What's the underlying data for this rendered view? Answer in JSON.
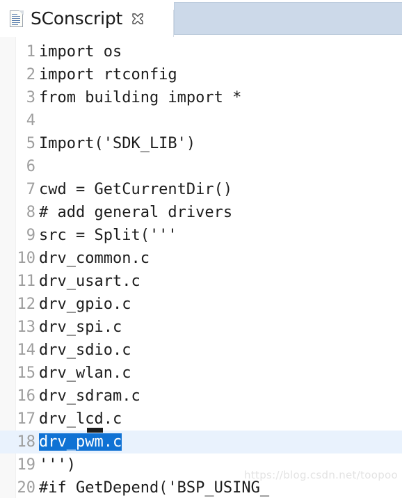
{
  "window": {
    "type": "code-editor",
    "colors": {
      "background": "#ffffff",
      "tab_inactive_area": "#ccd9e9",
      "line_number": "#9e9e9e",
      "code_text": "#1c1c1c",
      "selection": "#1072d4",
      "selection_text": "#ffffff",
      "current_line": "#e9f2fd",
      "marker_bar": "#f8f8f8"
    }
  },
  "tab_bar": {
    "tabs": [
      {
        "label": "SConscript",
        "icon": "file-document-icon",
        "close_icon": "close-x-icon",
        "active": true
      }
    ]
  },
  "editor": {
    "language": "python",
    "current_line": 18,
    "selection": {
      "line": 18,
      "text": "drv_pwm.c"
    },
    "lines": [
      {
        "n": "1",
        "text": "import os"
      },
      {
        "n": "2",
        "text": "import rtconfig"
      },
      {
        "n": "3",
        "text": "from building import *"
      },
      {
        "n": "4",
        "text": ""
      },
      {
        "n": "5",
        "text": "Import('SDK_LIB')"
      },
      {
        "n": "6",
        "text": ""
      },
      {
        "n": "7",
        "text": "cwd = GetCurrentDir()"
      },
      {
        "n": "8",
        "text": "# add general drivers"
      },
      {
        "n": "9",
        "text": "src = Split('''"
      },
      {
        "n": "10",
        "text": "drv_common.c"
      },
      {
        "n": "11",
        "text": "drv_usart.c"
      },
      {
        "n": "12",
        "text": "drv_gpio.c"
      },
      {
        "n": "13",
        "text": "drv_spi.c"
      },
      {
        "n": "14",
        "text": "drv_sdio.c"
      },
      {
        "n": "15",
        "text": "drv_wlan.c"
      },
      {
        "n": "16",
        "text": "drv_sdram.c"
      },
      {
        "n": "17",
        "text": "drv_lcd.c"
      },
      {
        "n": "18",
        "text": "drv_pwm.c",
        "selected": true
      },
      {
        "n": "19",
        "text": "''')"
      },
      {
        "n": "20",
        "text": "#if GetDepend('BSP_USING_"
      }
    ]
  },
  "watermark": {
    "text": "https://blog.csdn.net/toopoo"
  }
}
